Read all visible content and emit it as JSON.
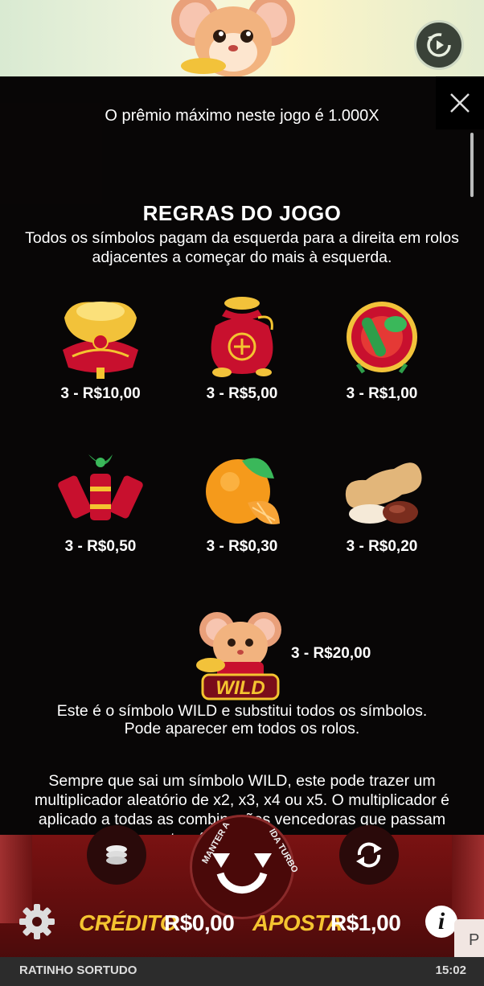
{
  "overlay": {
    "max_prize": "O prêmio máximo neste jogo é 1.000X",
    "rules_title": "REGRAS DO JOGO",
    "rules_desc": "Todos os símbolos pagam da esquerda para a direita em rolos adjacentes a começar do mais à esquerda.",
    "symbols": [
      {
        "icon": "gold-ingot-icon",
        "pay": "3 - R$10,00"
      },
      {
        "icon": "lucky-bag-icon",
        "pay": "3 - R$5,00"
      },
      {
        "icon": "drum-icon",
        "pay": "3 - R$1,00"
      },
      {
        "icon": "firecrackers-icon",
        "pay": "3 - R$0,50"
      },
      {
        "icon": "orange-icon",
        "pay": "3 - R$0,30"
      },
      {
        "icon": "peanuts-icon",
        "pay": "3 - R$0,20"
      }
    ],
    "wild": {
      "icon": "wild-mouse-icon",
      "badge": "WILD",
      "pay": "3 - R$20,00",
      "desc_line1": "Este é o símbolo WILD e substitui todos os símbolos.",
      "desc_line2": "Pode aparecer em todos os rolos.",
      "multiplier": "Sempre que sai um símbolo WILD, este pode trazer um multiplicador aleatório de x2, x3, x4 ou x5. O multiplicador é aplicado a todas as combinações vencedoras que passam através do WILD que o"
    }
  },
  "controls": {
    "spin_left_label": "MANTER A",
    "spin_right_label": "IDA TURBO",
    "credit_label": "CRÉDITO",
    "credit_value": "R$0,00",
    "bet_label": "APOSTA",
    "bet_value": "R$1,00",
    "info_label": "i",
    "side_tab": "P"
  },
  "footer": {
    "game_name": "RATINHO SORTUDO",
    "time": "15:02"
  },
  "colors": {
    "gold": "#f4c430",
    "red": "#c8102e",
    "overlay": "#080606"
  }
}
